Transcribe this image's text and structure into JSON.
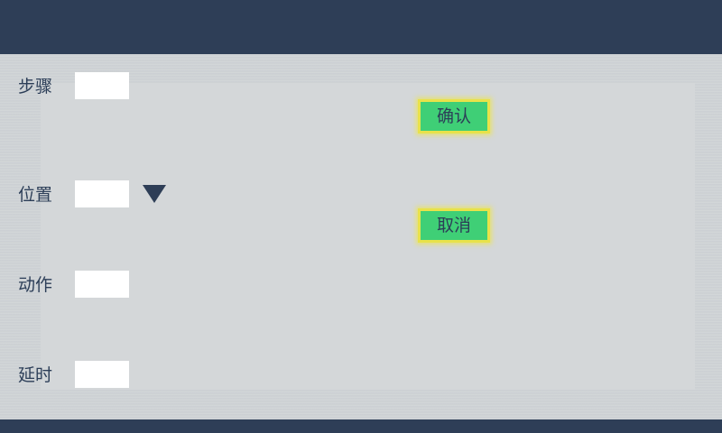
{
  "form": {
    "fields": [
      {
        "label": "步骤",
        "value": ""
      },
      {
        "label": "位置",
        "value": ""
      },
      {
        "label": "动作",
        "value": ""
      },
      {
        "label": "延时",
        "value": ""
      }
    ],
    "dropdown_icon": "triangle-down-icon"
  },
  "actions": {
    "confirm_label": "确认",
    "cancel_label": "取消"
  },
  "colors": {
    "header_bg": "#2e3e57",
    "panel_bg": "#d3d6d8",
    "button_bg": "#3fcf76",
    "button_glow": "#e8e24a",
    "text": "#2c3e58"
  }
}
